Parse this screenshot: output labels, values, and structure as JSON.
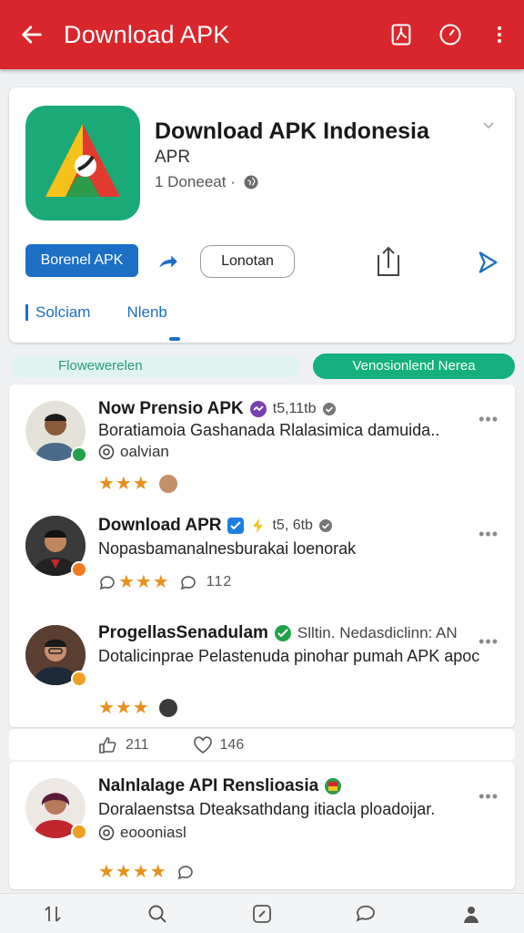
{
  "appbar": {
    "title": "Download APK"
  },
  "app": {
    "title": "Download APK Indonesia",
    "subtitle": "APR",
    "meta": "1 Doneeat ·",
    "primary_button": "Borenel APK",
    "outline_button": "Lonotan",
    "tab_1": "Solciam",
    "tab_2": "Nlenb"
  },
  "filters": {
    "left": "Flowewerelen",
    "right": "Venosionlend Nerea"
  },
  "reviews": [
    {
      "name": "Now Prensio APK",
      "meta": "t5,11tb",
      "text": "Boratiamoia Gashanada Rlalasimica damuida..",
      "sub": "oalvian",
      "stars": "★★★"
    },
    {
      "name": "Download APR",
      "meta": "t5, 6tb",
      "text": "Nopasbamanalnesburakai loenorak",
      "stars": "★★★",
      "count": "112"
    },
    {
      "name": "ProgellasSenadulam",
      "meta": "Slltin. Nedasdiclinn: AN",
      "text": "Dotalicinprae Pelastenuda pinohar pumah APK apoc",
      "stars": "★★★"
    },
    {
      "name": "Nalnlalage API Renslioasia",
      "text": "Doralaenstsa Dteaksathdang itiacla ploadoijar.",
      "sub": "eoooniasl",
      "stars": "★★★★"
    }
  ],
  "reactions": {
    "likes": "211",
    "hearts": "146"
  },
  "colors": {
    "appbar": "#d9262c",
    "primary": "#1c6fc4",
    "accent_green": "#14b07d",
    "star": "#e8901a"
  }
}
